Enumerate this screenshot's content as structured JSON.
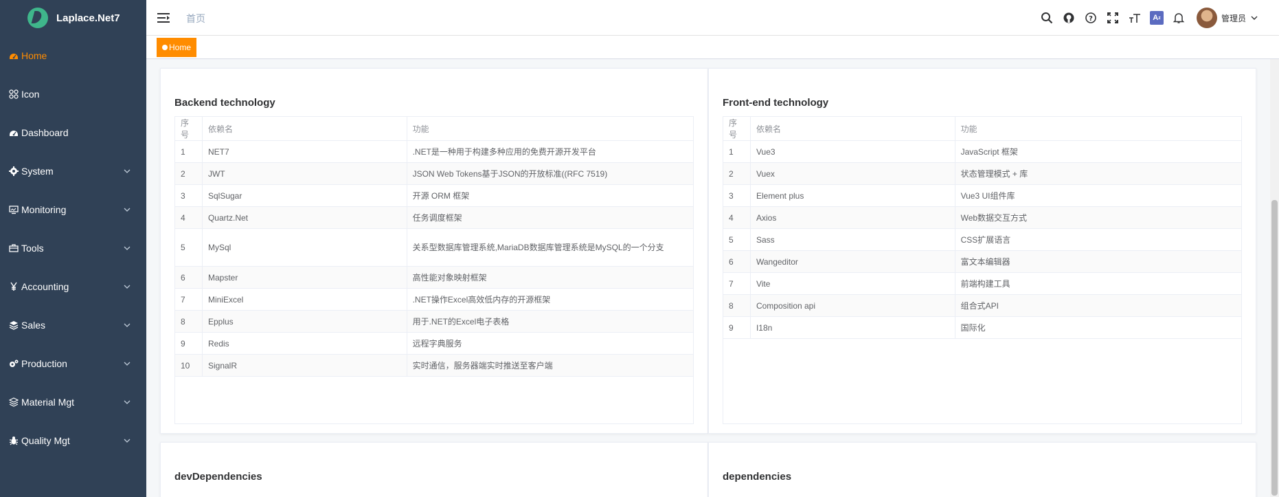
{
  "app": {
    "title": "Laplace.Net7"
  },
  "sidebar": {
    "items": [
      {
        "label": "Home",
        "icon": "dashboard-icon",
        "active": true,
        "has_children": false
      },
      {
        "label": "Icon",
        "icon": "grid-icon",
        "active": false,
        "has_children": false
      },
      {
        "label": "Dashboard",
        "icon": "dashboard-icon",
        "active": false,
        "has_children": false
      },
      {
        "label": "System",
        "icon": "gear-icon",
        "active": false,
        "has_children": true
      },
      {
        "label": "Monitoring",
        "icon": "monitor-icon",
        "active": false,
        "has_children": true
      },
      {
        "label": "Tools",
        "icon": "toolbox-icon",
        "active": false,
        "has_children": true
      },
      {
        "label": "Accounting",
        "icon": "yen-icon",
        "active": false,
        "has_children": true
      },
      {
        "label": "Sales",
        "icon": "stack-icon",
        "active": false,
        "has_children": true
      },
      {
        "label": "Production",
        "icon": "cogs-icon",
        "active": false,
        "has_children": true
      },
      {
        "label": "Material Mgt",
        "icon": "layers-icon",
        "active": false,
        "has_children": true
      },
      {
        "label": "Quality Mgt",
        "icon": "bug-icon",
        "active": false,
        "has_children": true
      }
    ]
  },
  "header": {
    "breadcrumb": "首页",
    "user_name": "管理员",
    "lang_badge": "A",
    "icons": [
      "search-icon",
      "github-icon",
      "help-icon",
      "fullscreen-icon",
      "font-size-icon",
      "translate-icon",
      "bell-icon"
    ]
  },
  "tags": {
    "active_label": "Home"
  },
  "backend": {
    "title": "Backend technology",
    "columns": [
      "序号",
      "依赖名",
      "功能"
    ],
    "rows": [
      [
        "1",
        "NET7",
        ".NET是一种用于构建多种应用的免费开源开发平台"
      ],
      [
        "2",
        "JWT",
        "JSON Web Tokens基于JSON的开放标准((RFC 7519)"
      ],
      [
        "3",
        "SqlSugar",
        "开源 ORM 框架"
      ],
      [
        "4",
        "Quartz.Net",
        "任务调度框架"
      ],
      [
        "5",
        "MySql",
        "关系型数据库管理系统,MariaDB数据库管理系统是MySQL的一个分支"
      ],
      [
        "6",
        "Mapster",
        "高性能对象映射框架"
      ],
      [
        "7",
        "MiniExcel",
        ".NET操作Excel高效低内存的开源框架"
      ],
      [
        "8",
        "Epplus",
        "用于.NET的Excel电子表格"
      ],
      [
        "9",
        "Redis",
        "远程字典服务"
      ],
      [
        "10",
        "SignalR",
        "实时通信，服务器端实时推送至客户端"
      ]
    ]
  },
  "frontend": {
    "title": "Front-end technology",
    "columns": [
      "序号",
      "依赖名",
      "功能"
    ],
    "rows": [
      [
        "1",
        "Vue3",
        "JavaScript 框架"
      ],
      [
        "2",
        "Vuex",
        "状态管理模式 + 库"
      ],
      [
        "3",
        "Element plus",
        "Vue3 UI组件库"
      ],
      [
        "4",
        "Axios",
        "Web数据交互方式"
      ],
      [
        "5",
        "Sass",
        "CSS扩展语言"
      ],
      [
        "6",
        "Wangeditor",
        "富文本编辑器"
      ],
      [
        "7",
        "Vite",
        "前端构建工具"
      ],
      [
        "8",
        "Composition api",
        "组合式API"
      ],
      [
        "9",
        "I18n",
        "国际化"
      ]
    ]
  },
  "dev": {
    "title": "devDependencies"
  },
  "deps": {
    "title": "dependencies"
  },
  "colors": {
    "sidebar_bg": "#304156",
    "accent": "#ff8c00",
    "text": "#303133"
  }
}
